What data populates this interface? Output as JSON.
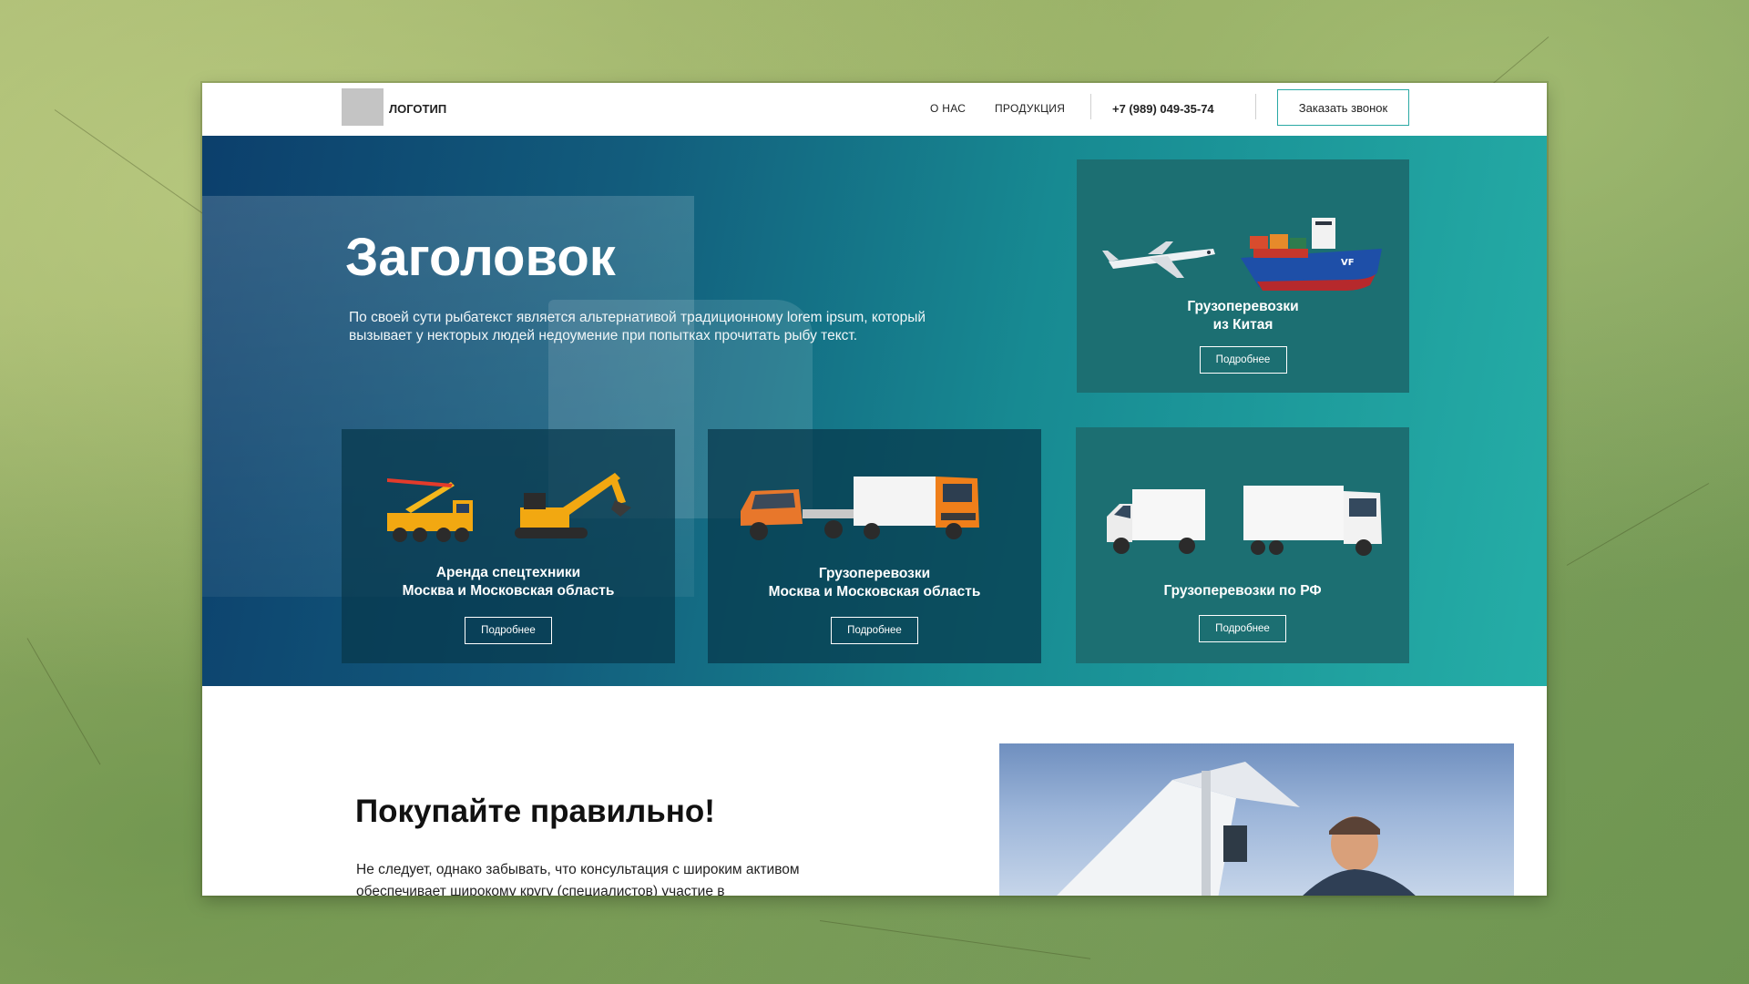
{
  "header": {
    "logo_label": "ЛОГОТИП",
    "nav": [
      "О НАС",
      "ПРОДУКЦИЯ"
    ],
    "phone": "+7 (989) 049-35-74",
    "call_button": "Заказать звонок"
  },
  "hero": {
    "title": "Заголовок",
    "text": "По своей сути рыбатекст является альтернативой традиционному lorem ipsum, который вызывает у некторых людей недоумение при попытках прочитать рыбу текст."
  },
  "cards": [
    {
      "title_line1": "Грузоперевозки",
      "title_line2": "из Китая",
      "button": "Подробнее",
      "icon": "plane-ship-icon"
    },
    {
      "title_line1": "Аренда спецтехники",
      "title_line2": "Москва и Московская область",
      "button": "Подробнее",
      "icon": "crane-excavator-icon"
    },
    {
      "title_line1": "Грузоперевозки",
      "title_line2": "Москва и Московская область",
      "button": "Подробнее",
      "icon": "trucks-icon"
    },
    {
      "title_line1": "Грузоперевозки по РФ",
      "title_line2": "",
      "button": "Подробнее",
      "icon": "vans-icon"
    }
  ],
  "section2": {
    "title": "Покупайте правильно!",
    "text": "Не следует, однако забывать, что консультация с широким активом обеспечивает широкому кругу (специалистов) участие в"
  },
  "colors": {
    "accent": "#2aa9a4",
    "hero_start": "#0c3f6c",
    "hero_end": "#25aea7"
  }
}
